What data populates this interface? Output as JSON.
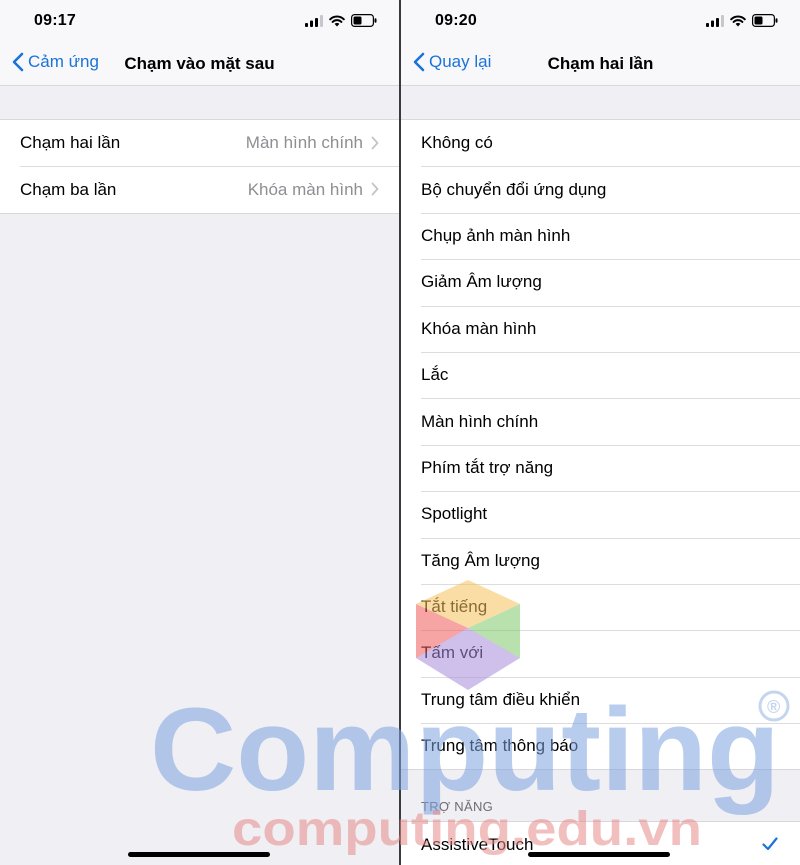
{
  "left_screen": {
    "status": {
      "time": "09:17"
    },
    "nav": {
      "back_label": "Cảm ứng",
      "title": "Chạm vào mặt sau"
    },
    "rows": [
      {
        "label": "Chạm hai lần",
        "value": "Màn hình chính"
      },
      {
        "label": "Chạm ba lần",
        "value": "Khóa màn hình"
      }
    ]
  },
  "right_screen": {
    "status": {
      "time": "09:20"
    },
    "nav": {
      "back_label": "Quay lại",
      "title": "Chạm hai lần"
    },
    "options": [
      "Không có",
      "Bộ chuyển đổi ứng dụng",
      "Chụp ảnh màn hình",
      "Giảm Âm lượng",
      "Khóa màn hình",
      "Lắc",
      "Màn hình chính",
      "Phím tắt trợ năng",
      "Spotlight",
      "Tăng Âm lượng",
      "Tắt tiếng",
      "Tấm với",
      "Trung tâm điều khiển",
      "Trung tâm thông báo"
    ],
    "accessibility_section": {
      "header": "TRỢ NĂNG",
      "items": [
        {
          "label": "AssistiveTouch",
          "selected": true
        }
      ]
    }
  },
  "watermark": {
    "logo_text": "Computing",
    "site_text": "computing.edu.vn"
  },
  "colors": {
    "accent": "#1a73d9",
    "background": "#efeff4",
    "secondary_text": "#8e8e93"
  },
  "icons": [
    "signal-icon",
    "wifi-icon",
    "battery-icon",
    "back-chevron-icon",
    "chevron-right-icon",
    "checkmark-icon"
  ]
}
